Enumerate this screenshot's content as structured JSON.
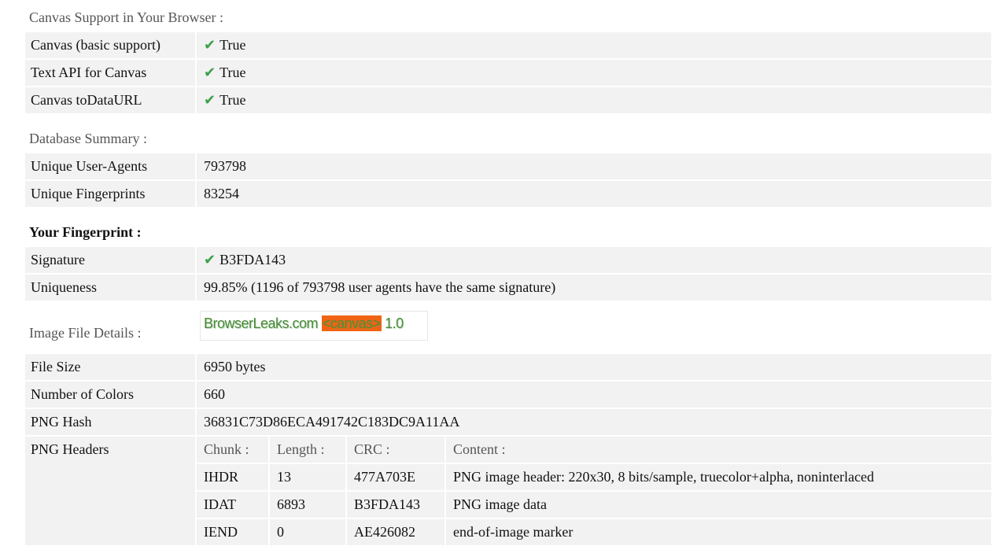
{
  "canvas_support": {
    "title": "Canvas Support in Your Browser :",
    "rows": [
      {
        "label": "Canvas (basic support)",
        "check": "✔",
        "value": "True"
      },
      {
        "label": "Text API for Canvas",
        "check": "✔",
        "value": "True"
      },
      {
        "label": "Canvas toDataURL",
        "check": "✔",
        "value": "True"
      }
    ]
  },
  "database_summary": {
    "title": "Database Summary :",
    "rows": [
      {
        "label": "Unique User-Agents",
        "value": "793798"
      },
      {
        "label": "Unique Fingerprints",
        "value": "83254"
      }
    ]
  },
  "fingerprint": {
    "title": "Your Fingerprint :",
    "signature_label": "Signature",
    "signature_check": "✔",
    "signature_value": "B3FDA143",
    "uniqueness_label": "Uniqueness",
    "uniqueness_value": "99.85% (1196 of 793798 user agents have the same signature)"
  },
  "image_details": {
    "title": "Image File Details :",
    "canvas_image": {
      "text_before": "BrowserLeaks.com ",
      "text_highlight": "<canvas>",
      "text_after": " 1.0",
      "highlight_color": "#f06414"
    },
    "rows": [
      {
        "label": "File Size",
        "value": "6950 bytes"
      },
      {
        "label": "Number of Colors",
        "value": "660"
      },
      {
        "label": "PNG Hash",
        "value": "36831C73D86ECA491742C183DC9A11AA"
      }
    ],
    "png_headers": {
      "label": "PNG Headers",
      "columns": [
        "Chunk :",
        "Length :",
        "CRC :",
        "Content :"
      ],
      "rows": [
        [
          "IHDR",
          "13",
          "477A703E",
          "PNG image header: 220x30, 8 bits/sample, truecolor+alpha, noninterlaced"
        ],
        [
          "IDAT",
          "6893",
          "B3FDA143",
          "PNG image data"
        ],
        [
          "IEND",
          "0",
          "AE426082",
          "end-of-image marker"
        ]
      ]
    }
  },
  "colors": {
    "row_background": "#f2f2f2",
    "check_green": "#3aa04a"
  }
}
